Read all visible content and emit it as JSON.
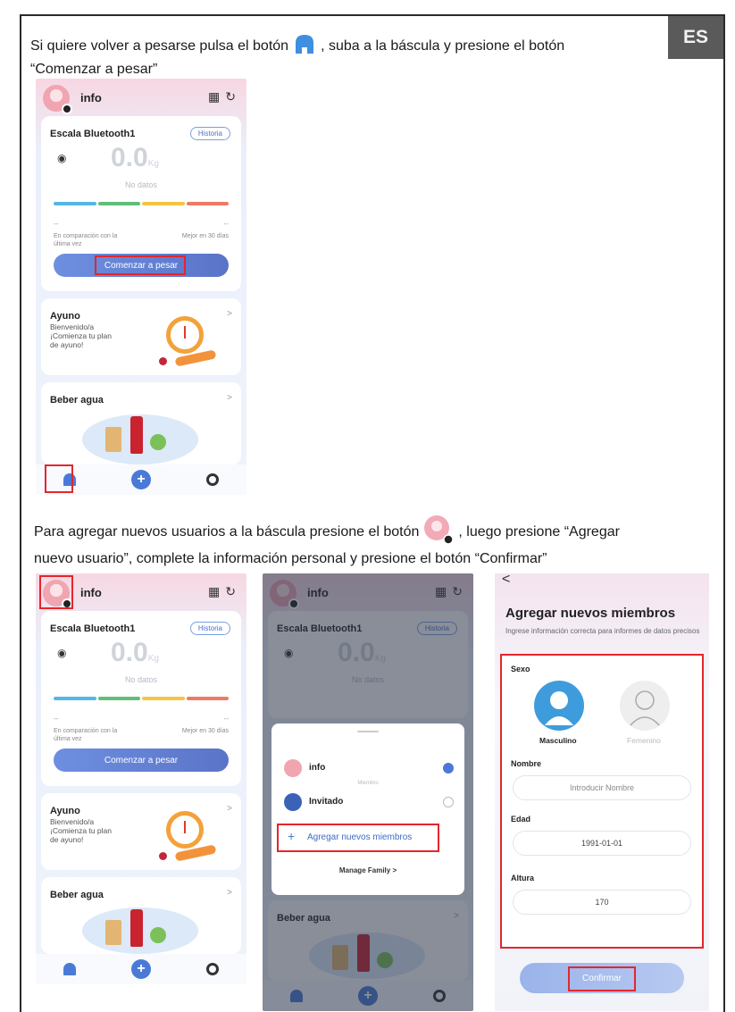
{
  "lang": "ES",
  "instr1": {
    "part1": "Si quiere volver a pesarse pulsa el botón",
    "part2": ", suba a la báscula y presione el botón",
    "part3": "“Comenzar a pesar”"
  },
  "instr2": {
    "part1": "Para agregar nuevos usuarios a la báscula presione el botón",
    "part2": ", luego presione “Agregar",
    "part3": "nuevo usuario”, complete la información personal y presione el botón “Confirmar”"
  },
  "app": {
    "user": "info",
    "scale_name": "Escala Bluetooth1",
    "history": "Historia",
    "weight_value": "0.0",
    "weight_unit": "Kg",
    "no_data": "No datos",
    "dash": "--",
    "compare_left": "En comparación con la última vez",
    "compare_right": "Mejor en 30 días",
    "start_button": "Comenzar a pesar",
    "fasting_title": "Ayuno",
    "fasting_text": "Bienvenido/a ¡Comienza tu plan de ayuno!",
    "water_title": "Beber agua",
    "chevron": ">"
  },
  "sheet": {
    "member1": "info",
    "members_label": "Miembro",
    "member2": "Invitado",
    "add_members": "Agregar nuevos miembros",
    "manage_family": "Manage Family",
    "plus": "+"
  },
  "form": {
    "back": "<",
    "title": "Agregar nuevos miembros",
    "subtitle": "Ingrese información correcta para informes de datos precisos",
    "sex_label": "Sexo",
    "male": "Masculino",
    "female": "Femenino",
    "name_label": "Nombre",
    "name_placeholder": "Introducir Nombre",
    "age_label": "Edad",
    "age_value": "1991-01-01",
    "height_label": "Altura",
    "height_value": "170",
    "confirm": "Confirmar"
  },
  "colors": {
    "accent": "#4a7ad6",
    "highlight": "#e3262d",
    "bar": [
      "#52b8e6",
      "#5fbf7a",
      "#f4c542",
      "#ee7a63"
    ]
  }
}
